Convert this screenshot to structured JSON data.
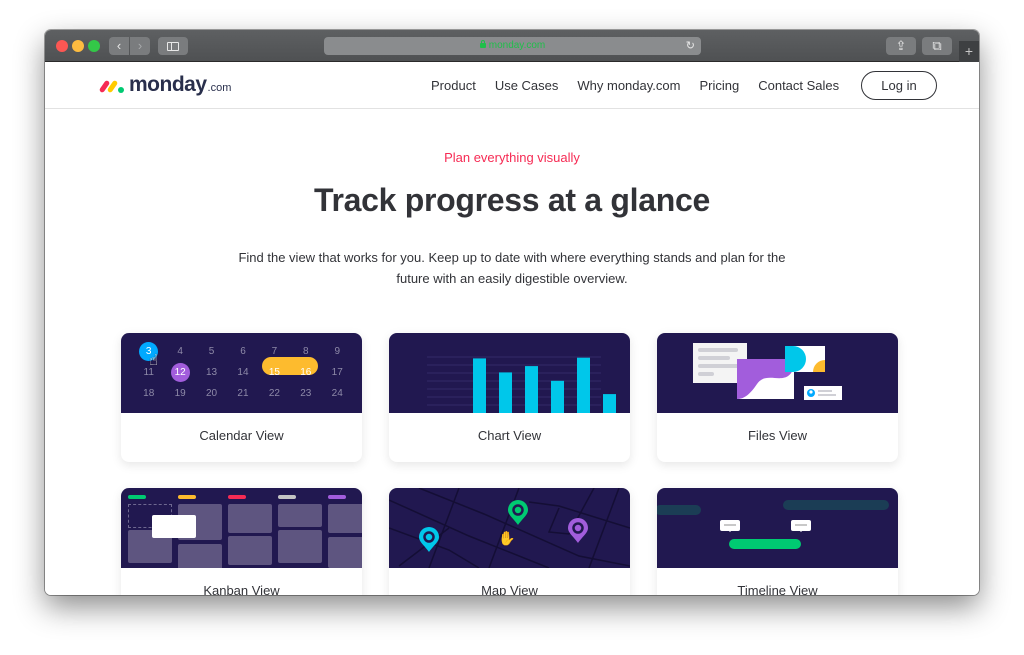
{
  "browser": {
    "url": "monday.com",
    "buttons": {
      "back": "‹",
      "forward": "›",
      "reload": "↻",
      "share": "⇪",
      "tabs": "⧉",
      "new_tab": "+"
    }
  },
  "header": {
    "logo_text": "monday",
    "logo_suffix": ".com",
    "nav": [
      "Product",
      "Use Cases",
      "Why monday.com",
      "Pricing",
      "Contact Sales"
    ],
    "login_label": "Log in"
  },
  "hero": {
    "eyebrow": "Plan everything visually",
    "title": "Track progress at a glance",
    "description": "Find the view that works for you. Keep up to date with where everything stands and plan for the future with an easily digestible overview."
  },
  "colors": {
    "accent_pink": "#f62b54",
    "card_art_bg": "#211850",
    "chart_bar": "#00c7ea",
    "blue": "#00a9ff",
    "purple": "#a25ddc",
    "yellow": "#fdbb2e",
    "green": "#00ca72"
  },
  "views": [
    {
      "label": "Calendar View",
      "calendar": {
        "rows": [
          [
            "3",
            "4",
            "5",
            "6",
            "7",
            "8",
            "9"
          ],
          [
            "11",
            "12",
            "13",
            "14",
            "15",
            "16",
            "17"
          ],
          [
            "18",
            "19",
            "20",
            "21",
            "22",
            "23",
            "24"
          ]
        ],
        "selected_blue": "3",
        "selected_purple": "12",
        "range": [
          "15",
          "16"
        ],
        "cursor": "☝"
      }
    },
    {
      "label": "Chart View",
      "bars": [
        0.78,
        0.58,
        0.67,
        0.46,
        0.79,
        0.27
      ]
    },
    {
      "label": "Files View"
    },
    {
      "label": "Kanban View",
      "column_tags": [
        "#00ca72",
        "#fdbb2e",
        "#f62b54",
        "#c4c4c4",
        "#a25ddc"
      ]
    },
    {
      "label": "Map View",
      "pins": [
        "#00c7ea",
        "#00ca72",
        "#a25ddc"
      ],
      "cursor": "✋"
    },
    {
      "label": "Timeline View"
    }
  ]
}
